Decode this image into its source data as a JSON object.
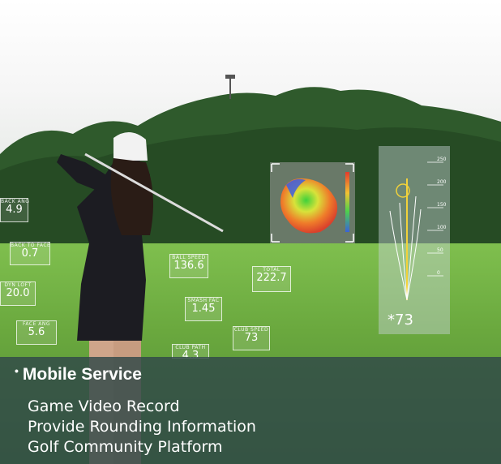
{
  "hero": {
    "stats": [
      {
        "label": "BACK ANG",
        "value": "4.9"
      },
      {
        "label": "BACK TO FACE",
        "value": "0.7"
      },
      {
        "label": "DYN LOFT",
        "value": "20.0"
      },
      {
        "label": "FACE ANG",
        "value": "5.6"
      },
      {
        "label": "BALL SPEED",
        "value": "136.6"
      },
      {
        "label": "SMASH FAC",
        "value": "1.45"
      },
      {
        "label": "CLUB PATH",
        "value": "4.3"
      },
      {
        "label": "TOTAL",
        "value": "222.7"
      },
      {
        "label": "CLUB SPEED",
        "value": "73"
      }
    ],
    "tracker": {
      "label": "",
      "value": "*73",
      "ticks": [
        "250",
        "200",
        "150",
        "100",
        "50",
        "0"
      ]
    }
  },
  "service": {
    "title": "Mobile Service",
    "items": [
      "Game Video Record",
      "Provide Rounding Information",
      "Golf Community Platform"
    ]
  }
}
